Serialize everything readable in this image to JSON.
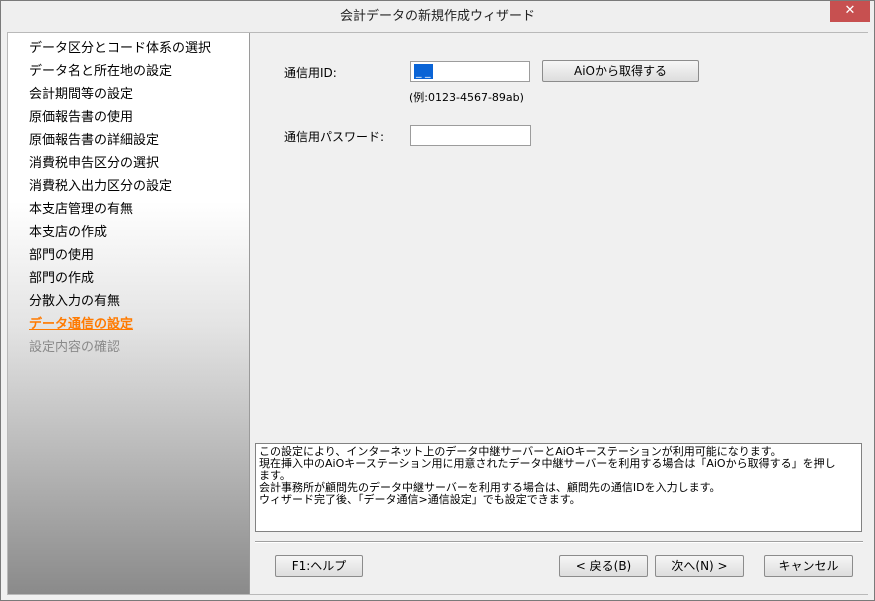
{
  "window": {
    "title": "会計データの新規作成ウィザード",
    "close_glyph": "✕"
  },
  "steps": [
    {
      "label": "データ区分とコード体系の選択",
      "state": "done"
    },
    {
      "label": "データ名と所在地の設定",
      "state": "done"
    },
    {
      "label": "会計期間等の設定",
      "state": "done"
    },
    {
      "label": "原価報告書の使用",
      "state": "done"
    },
    {
      "label": "原価報告書の詳細設定",
      "state": "done"
    },
    {
      "label": "消費税申告区分の選択",
      "state": "done"
    },
    {
      "label": "消費税入出力区分の設定",
      "state": "done"
    },
    {
      "label": "本支店管理の有無",
      "state": "done"
    },
    {
      "label": "本支店の作成",
      "state": "done"
    },
    {
      "label": "部門の使用",
      "state": "done"
    },
    {
      "label": "部門の作成",
      "state": "done"
    },
    {
      "label": "分散入力の有無",
      "state": "done"
    },
    {
      "label": "データ通信の設定",
      "state": "current"
    },
    {
      "label": "設定内容の確認",
      "state": "pending"
    }
  ],
  "form": {
    "id_label": "通信用ID:",
    "id_value": "_ _",
    "aio_button": "AiOから取得する",
    "id_hint": "(例:0123-4567-89ab)",
    "password_label": "通信用パスワード:",
    "password_value": ""
  },
  "info_lines": [
    "この設定により、インターネット上のデータ中継サーバーとAiOキーステーションが利用可能になります。",
    "現在挿入中のAiOキーステーション用に用意されたデータ中継サーバーを利用する場合は「AiOから取得する」を押し",
    "ます。",
    "会計事務所が顧問先のデータ中継サーバーを利用する場合は、顧問先の通信IDを入力します。",
    "ウィザード完了後、「データ通信>通信設定」でも設定できます。"
  ],
  "footer": {
    "help": "F1:ヘルプ",
    "back": "< 戻る(B)",
    "next": "次へ(N) >",
    "cancel": "キャンセル"
  },
  "colors": {
    "current_step": "#ff7a00",
    "pending_step": "#8a8a8a",
    "selection": "#0a64d6"
  }
}
